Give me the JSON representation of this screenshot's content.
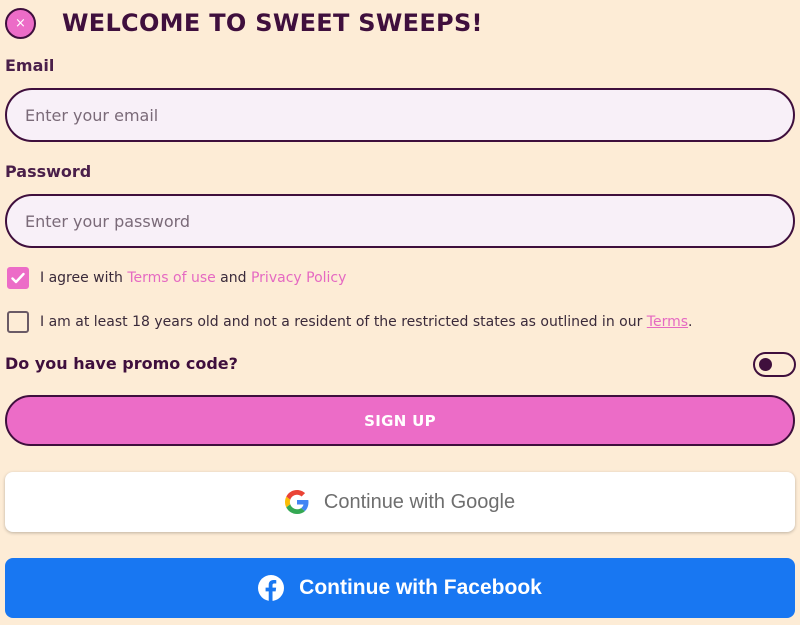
{
  "header": {
    "close_symbol": "×",
    "title": "WELCOME TO SWEET SWEEPS!"
  },
  "form": {
    "email": {
      "label": "Email",
      "placeholder": "Enter your email",
      "value": ""
    },
    "password": {
      "label": "Password",
      "placeholder": "Enter your password",
      "value": ""
    },
    "terms_checkbox": {
      "checked": true,
      "text_before": "I agree with ",
      "terms_link": "Terms of use",
      "text_middle": " and ",
      "privacy_link": "Privacy Policy"
    },
    "age_checkbox": {
      "checked": false,
      "text_before": "I am at least 18 years old and not a resident of the restricted states as outlined in our ",
      "terms_link": "Terms",
      "text_after": "."
    },
    "promo": {
      "label": "Do you have promo code?",
      "enabled": false
    },
    "signup_label": "SIGN UP"
  },
  "social": {
    "google_label": "Continue with Google",
    "facebook_label": "Continue with Facebook"
  },
  "colors": {
    "background": "#fdecd6",
    "accent_pink": "#ec6cc7",
    "dark_purple": "#3f0f3d",
    "facebook_blue": "#1877f2"
  },
  "icons": {
    "close": "close-icon",
    "check": "checkmark-icon",
    "google": "google-logo-icon",
    "facebook": "facebook-logo-icon"
  }
}
